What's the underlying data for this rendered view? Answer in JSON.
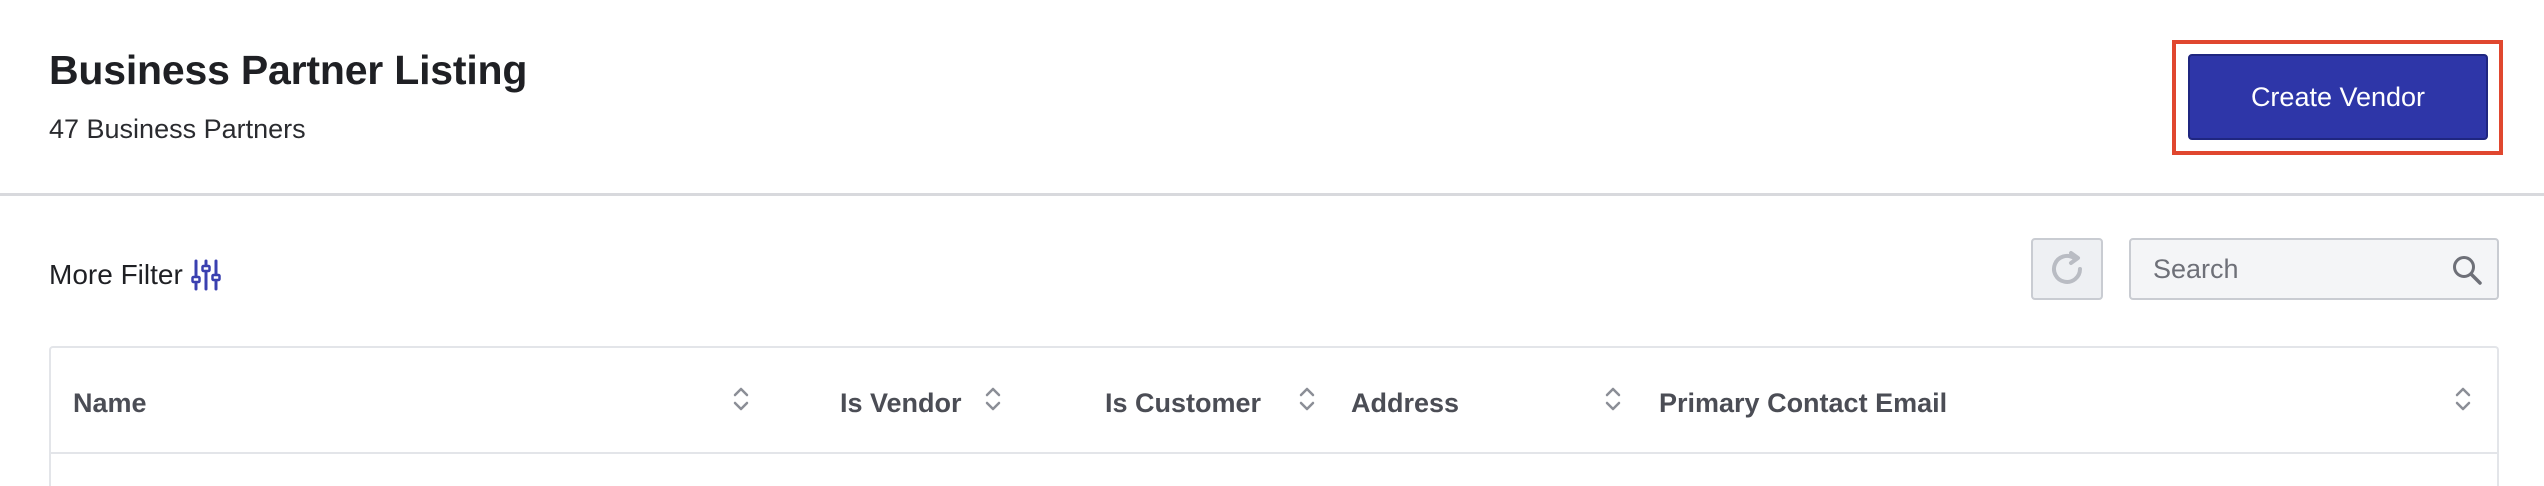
{
  "header": {
    "title": "Business Partner Listing",
    "subtitle": "47 Business Partners",
    "create_button_label": "Create Vendor"
  },
  "toolbar": {
    "more_filter_label": "More Filter",
    "filter_icon": "sliders-icon",
    "refresh_icon": "refresh-icon",
    "search": {
      "placeholder": "Search",
      "value": "",
      "icon": "search-icon"
    }
  },
  "table": {
    "columns": [
      {
        "label": "Name",
        "sortable": true
      },
      {
        "label": "Is Vendor",
        "sortable": true
      },
      {
        "label": "Is Customer",
        "sortable": true
      },
      {
        "label": "Address",
        "sortable": true
      },
      {
        "label": "Primary Contact Email",
        "sortable": true
      }
    ]
  },
  "colors": {
    "accent": "#2e36a8",
    "highlight_border": "#e0472f",
    "icon_accent": "#3a40b0"
  }
}
